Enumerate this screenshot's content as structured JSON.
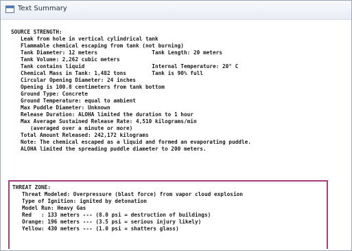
{
  "window": {
    "title": "Text Summary"
  },
  "source_strength": {
    "lines": [
      "SOURCE STRENGTH:",
      "   Leak from hole in vertical cylindrical tank",
      "   Flammable chemical escaping from tank (not burning)",
      "   Tank Diameter: 12 meters                 Tank Length: 20 meters",
      "   Tank Volume: 2,262 cubic meters",
      "   Tank contains liquid                     Internal Temperature: 20° C",
      "   Chemical Mass in Tank: 1,482 tons        Tank is 90% full",
      "   Circular Opening Diameter: 24 inches",
      "   Opening is 100.8 centimeters from tank bottom",
      "   Ground Type: Concrete",
      "   Ground Temperature: equal to ambient",
      "   Max Puddle Diameter: Unknown",
      "   Release Duration: ALOHA limited the duration to 1 hour",
      "   Max Average Sustained Release Rate: 4,510 kilograms/min",
      "      (averaged over a minute or more)",
      "   Total Amount Released: 242,172 kilograms",
      "   Note: The chemical escaped as a liquid and formed an evaporating puddle.",
      "   ALOHA limited the spreading puddle diameter to 200 meters."
    ]
  },
  "threat_zone": {
    "lines": [
      "THREAT ZONE:",
      "   Threat Modeled: Overpressure (blast force) from vapor cloud explosion",
      "   Type of Ignition: ignited by detonation",
      "   Model Run: Heavy Gas",
      "   Red   : 133 meters --- (8.0 psi = destruction of buildings)",
      "   Orange: 196 meters --- (3.5 psi = serious injury likely)",
      "   Yellow: 430 meters --- (1.0 psi = shatters glass)"
    ],
    "highlight_color": "#a33d7b"
  }
}
